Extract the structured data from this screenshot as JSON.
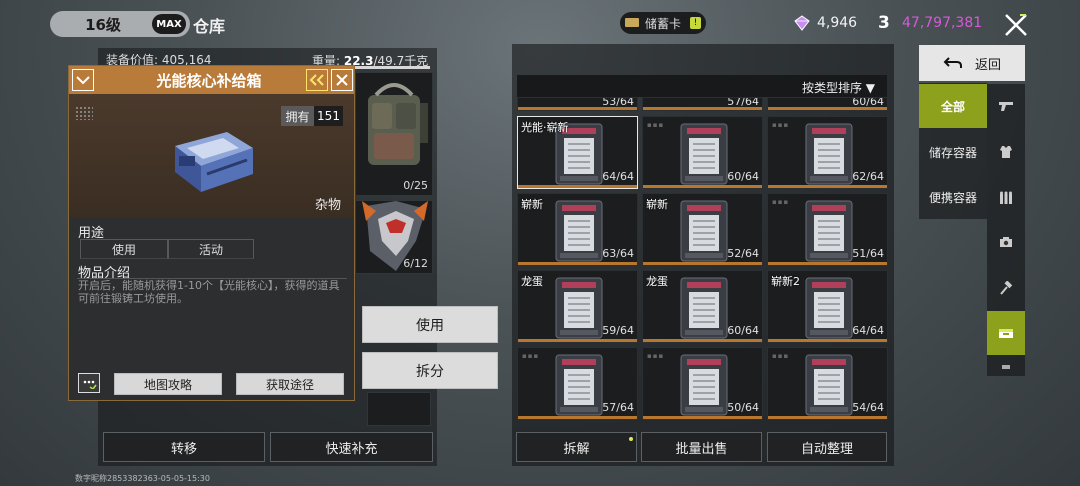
{
  "header": {
    "level": "16级",
    "max_badge": "MAX",
    "title": "仓库",
    "storage_card": "储蓄卡",
    "lock_glyph": "!",
    "gems": "4,946",
    "coin_symbol": "3",
    "coins": "47,797,381",
    "accent_purple": "#d45bd6"
  },
  "left": {
    "equip_value_label": "装备价值: ",
    "equip_value": "405,164",
    "weight_label": "重量: ",
    "weight_value": "22.3",
    "weight_max": "/49.7千克",
    "bag_count": "0/25",
    "mech_count": "6/12"
  },
  "popup": {
    "title": "光能核心补给箱",
    "own_label": "拥有",
    "own_count": "151",
    "category": "杂物",
    "use_section": "用途",
    "use_btn": "使用",
    "activity_btn": "活动",
    "desc_section": "物品介绍",
    "description": "开启后，能随机获得1-10个【光能核心】，获得的道具可前往锻铸工坊使用。",
    "map_btn": "地图攻略",
    "obtain_btn": "获取途径",
    "header_color": "#b97b3a"
  },
  "actions": {
    "use": "使用",
    "split": "拆分",
    "transfer": "转移",
    "quick_fill": "快速补充"
  },
  "watermark": "数字昵称2853382363-05-05-15:30",
  "grid": {
    "sort_label": "按类型排序 ▼",
    "top_counts": [
      "53/64",
      "57/64",
      "60/64"
    ],
    "cells": [
      {
        "tag": "光能·崭新",
        "count": "64/64"
      },
      {
        "tag": "",
        "count": "60/64"
      },
      {
        "tag": "",
        "count": "62/64"
      },
      {
        "tag": "崭新",
        "count": "63/64"
      },
      {
        "tag": "崭新",
        "count": "52/64"
      },
      {
        "tag": "",
        "count": "51/64"
      },
      {
        "tag": "龙蛋",
        "count": "59/64"
      },
      {
        "tag": "龙蛋",
        "count": "60/64"
      },
      {
        "tag": "崭新2",
        "count": "64/64"
      },
      {
        "tag": "",
        "count": "57/64"
      },
      {
        "tag": "",
        "count": "50/64"
      },
      {
        "tag": "",
        "count": "54/64"
      }
    ],
    "disassemble": "拆解",
    "bulk_sell": "批量出售",
    "auto_sort": "自动整理"
  },
  "side": {
    "back": "返回",
    "all": "全部",
    "storage_container": "储存容器",
    "portable_container": "便携容器",
    "accent_green": "#8ea11c"
  }
}
